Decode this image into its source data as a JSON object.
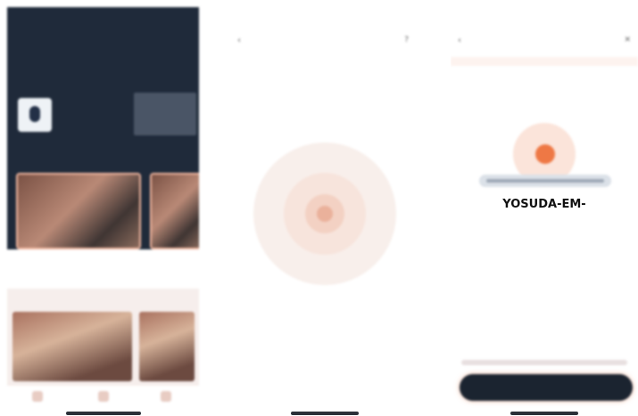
{
  "panel1": {
    "status": {
      "time": "",
      "indicators": ""
    },
    "nav": {
      "tabs": [
        "",
        "",
        "",
        ""
      ],
      "brand": ""
    },
    "brand_sub": "",
    "profile": {
      "name": "",
      "meta": ""
    },
    "section_label": "",
    "strip": {
      "t1": "",
      "t2": "",
      "t3": "",
      "t4": ""
    },
    "lower": {
      "header": ""
    }
  },
  "panel2": {
    "status": {
      "time": "",
      "indicators": ""
    },
    "header": {
      "back": "‹",
      "title": "",
      "help": "?"
    },
    "searching": "",
    "hint": ""
  },
  "panel3": {
    "status": {
      "time": "",
      "indicators": ""
    },
    "header": {
      "back": "‹",
      "title": "",
      "close": "✕"
    },
    "device_name": "YOSUDA-EM-",
    "connect_label": ""
  },
  "colors": {
    "accent": "#ee7845",
    "dark_bg": "#1f2a3a",
    "button_dark": "#1b2430"
  }
}
